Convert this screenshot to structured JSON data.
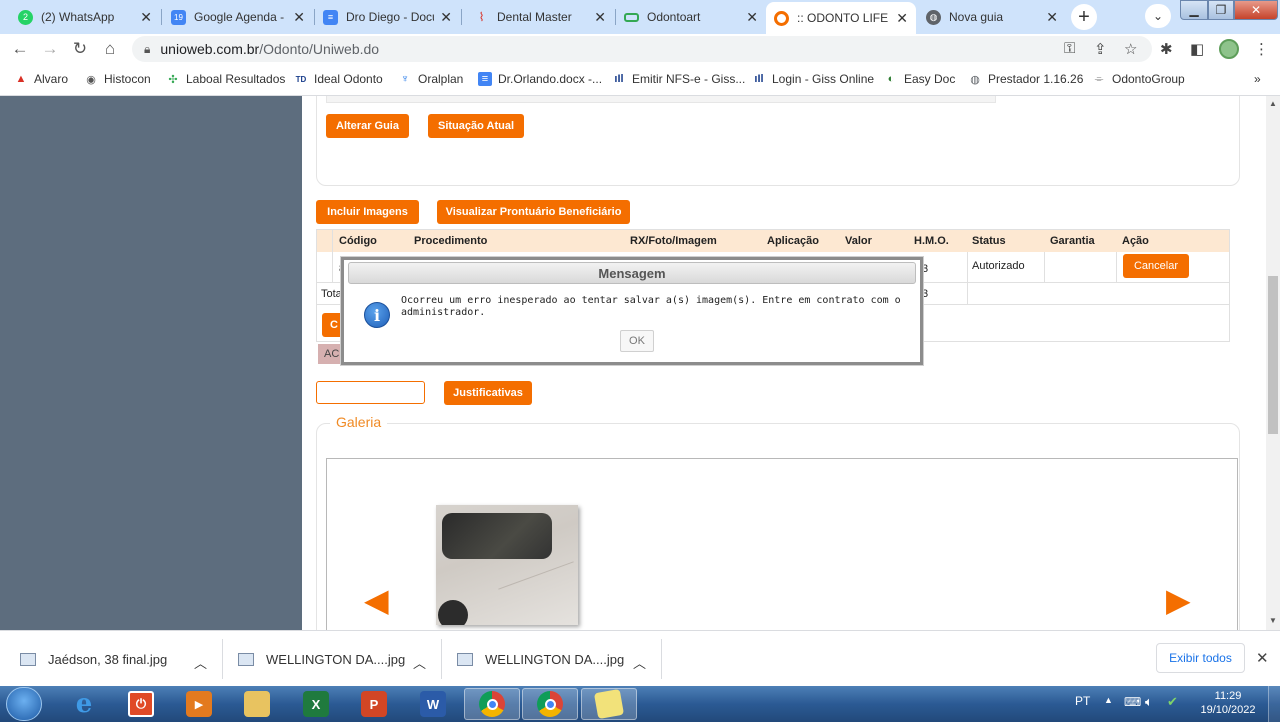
{
  "browser": {
    "tabs": [
      {
        "title": "(2) WhatsApp",
        "icon": "whatsapp-icon",
        "color": "#25d366",
        "badge": "2"
      },
      {
        "title": "Google Agenda - ",
        "icon": "google-calendar-icon",
        "color": "#4285f4",
        "badge": "19"
      },
      {
        "title": "Dro Diego - Docu",
        "icon": "google-docs-icon",
        "color": "#4285f4",
        "badge": ""
      },
      {
        "title": "Dental Master",
        "icon": "dental-master-icon",
        "color": "#d93025",
        "badge": ""
      },
      {
        "title": "Odontoart",
        "icon": "odontoart-icon",
        "color": "#34a853",
        "badge": ""
      },
      {
        "title": ":: ODONTO LIFE ::.",
        "icon": "odonto-life-icon",
        "color": "#f46e00",
        "badge": ""
      },
      {
        "title": "Nova guia",
        "icon": "new-tab-globe-icon",
        "color": "#5f6368",
        "badge": ""
      }
    ],
    "url_domain": "unioweb.com.br",
    "url_path": "/Odonto/Uniweb.do",
    "bookmarks": [
      {
        "label": "Alvaro",
        "icon": "triangle-icon",
        "color": "#d93025"
      },
      {
        "label": "Histocon",
        "icon": "histocon-icon",
        "color": "#555555"
      },
      {
        "label": "Laboal Resultados",
        "icon": "laboal-icon",
        "color": "#34a853"
      },
      {
        "label": "Ideal Odonto",
        "icon": "ideal-odonto-icon",
        "color": "#1a3e8c"
      },
      {
        "label": "Oralplan",
        "icon": "oralplan-icon",
        "color": "#1a73e8"
      },
      {
        "label": "Dr.Orlando.docx -...",
        "icon": "google-docs-icon",
        "color": "#4285f4"
      },
      {
        "label": "Emitir NFS-e - Giss...",
        "icon": "giss-icon",
        "color": "#1a3e8c"
      },
      {
        "label": "Login - Giss Online",
        "icon": "giss-icon",
        "color": "#1a3e8c"
      },
      {
        "label": "Easy Doc",
        "icon": "easy-doc-icon",
        "color": "#2e7d32"
      },
      {
        "label": "Prestador 1.16.26",
        "icon": "globe-icon",
        "color": "#5f6368"
      },
      {
        "label": "OdontoGroup",
        "icon": "odontogroup-icon",
        "color": "#777777"
      }
    ],
    "more_bookmarks": "»"
  },
  "page": {
    "buttons_top": {
      "alterar_guia": "Alterar Guia",
      "situacao_atual": "Situação Atual"
    },
    "buttons_mid": {
      "incluir_imagens": "Incluir Imagens",
      "visualizar_prontuario": "Visualizar Prontuário Beneficiário"
    },
    "table": {
      "headers": [
        "Código",
        "Procedimento",
        "RX/Foto/Imagem",
        "Aplicação",
        "Valor",
        "H.M.O.",
        "Status",
        "Garantia",
        "Ação"
      ],
      "row": {
        "codigo_partial": "8",
        "hmo_partial": "3",
        "status": "Autorizado",
        "acao": "Cancelar"
      },
      "total_label_partial": "Tota",
      "total_hmo_partial": "3",
      "orange_button_partial": "C",
      "tag_partial": "AC"
    },
    "justificativas": "Justificativas",
    "galeria_title": "Galeria",
    "gallery_prev": "◀",
    "gallery_next": "▶"
  },
  "dialog": {
    "title": "Mensagem",
    "message": "Ocorreu um erro inesperado ao tentar salvar a(s) imagem(s). Entre em contrato com o administrador.",
    "ok": "OK"
  },
  "downloads": {
    "items": [
      "Jaédson, 38 final.jpg",
      "WELLINGTON DA....jpg",
      "WELLINGTON DA....jpg"
    ],
    "show_all": "Exibir todos"
  },
  "taskbar": {
    "lang": "PT",
    "time": "11:29",
    "date": "19/10/2022"
  }
}
